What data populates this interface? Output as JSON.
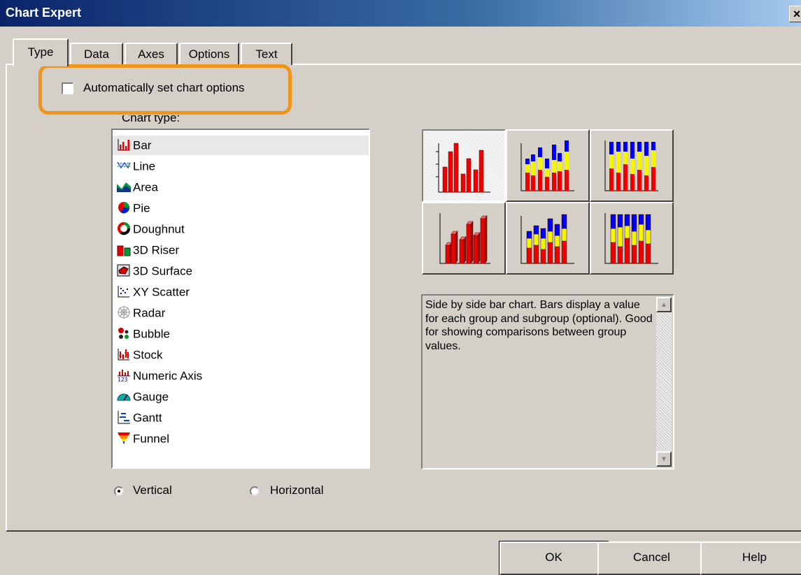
{
  "window": {
    "title": "Chart Expert",
    "close_glyph": "×"
  },
  "tabs": [
    {
      "label": "Type",
      "active": true
    },
    {
      "label": "Data"
    },
    {
      "label": "Axes"
    },
    {
      "label": "Options"
    },
    {
      "label": "Text"
    }
  ],
  "auto_option": {
    "label": "Automatically set chart options",
    "checked": false
  },
  "chart_type_label": "Chart type:",
  "chart_types": [
    {
      "label": "Bar",
      "icon": "bar-chart-icon",
      "selected": true
    },
    {
      "label": "Line",
      "icon": "line-chart-icon"
    },
    {
      "label": "Area",
      "icon": "area-chart-icon"
    },
    {
      "label": "Pie",
      "icon": "pie-chart-icon"
    },
    {
      "label": "Doughnut",
      "icon": "doughnut-chart-icon"
    },
    {
      "label": "3D Riser",
      "icon": "3d-riser-chart-icon"
    },
    {
      "label": "3D Surface",
      "icon": "3d-surface-chart-icon"
    },
    {
      "label": "XY Scatter",
      "icon": "xy-scatter-chart-icon"
    },
    {
      "label": "Radar",
      "icon": "radar-chart-icon"
    },
    {
      "label": "Bubble",
      "icon": "bubble-chart-icon"
    },
    {
      "label": "Stock",
      "icon": "stock-chart-icon"
    },
    {
      "label": "Numeric Axis",
      "icon": "numeric-axis-chart-icon"
    },
    {
      "label": "Gauge",
      "icon": "gauge-chart-icon"
    },
    {
      "label": "Gantt",
      "icon": "gantt-chart-icon"
    },
    {
      "label": "Funnel",
      "icon": "funnel-chart-icon"
    }
  ],
  "orientation": {
    "vertical_label": "Vertical",
    "horizontal_label": "Horizontal",
    "selected": "Vertical"
  },
  "subtypes": [
    {
      "icon": "side-by-side-bar-icon",
      "selected": true
    },
    {
      "icon": "stacked-bar-icon"
    },
    {
      "icon": "percent-bar-icon"
    },
    {
      "icon": "side-by-side-3d-bar-icon"
    },
    {
      "icon": "stacked-3d-bar-icon"
    },
    {
      "icon": "percent-3d-bar-icon"
    }
  ],
  "description": "Side by side bar chart. Bars display a value for each group and subgroup (optional). Good for showing comparisons between group values.",
  "buttons": {
    "ok": "OK",
    "cancel": "Cancel",
    "help": "Help"
  },
  "colors": {
    "highlight": "#f29418",
    "bar_red": "#ee0000",
    "bar_blue": "#0000ee",
    "bar_yellow": "#f5f500",
    "title_bar": "#0a246a"
  }
}
